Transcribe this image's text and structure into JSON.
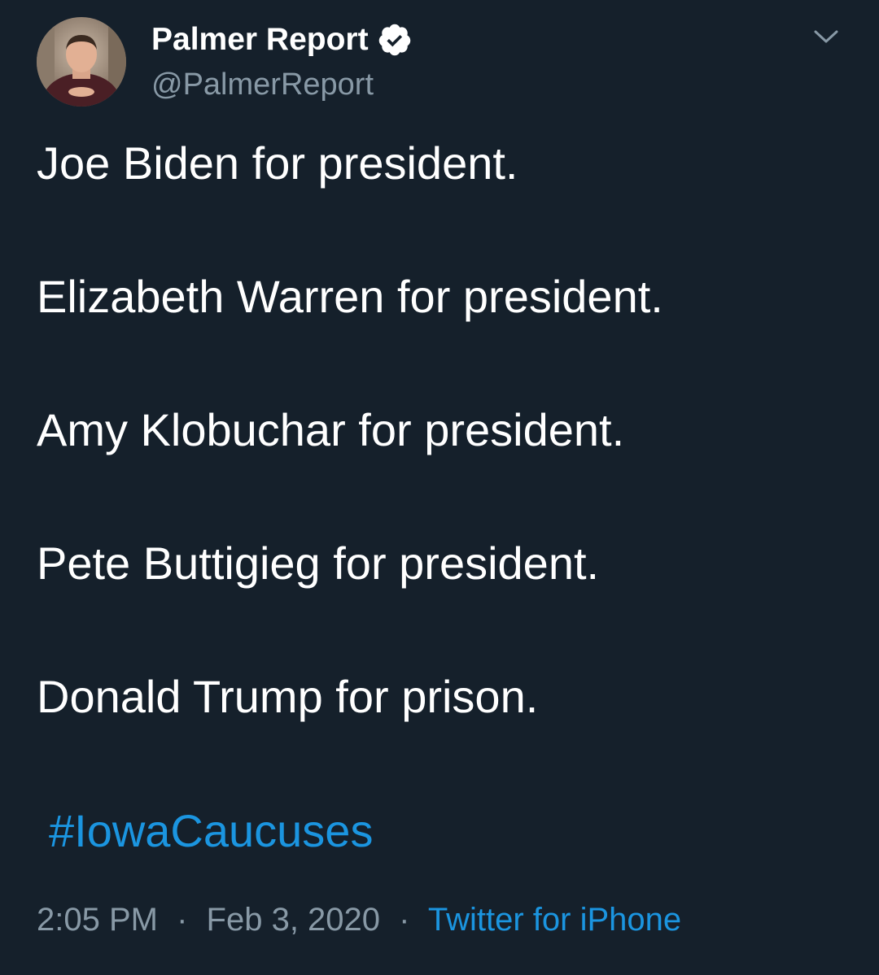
{
  "user": {
    "display_name": "Palmer Report",
    "handle": "@PalmerReport",
    "verified": true
  },
  "tweet": {
    "lines": [
      "Joe Biden for president.",
      "Elizabeth Warren for president.",
      "Amy Klobuchar for president.",
      "Pete Buttigieg for president.",
      "Donald Trump for prison."
    ],
    "hashtag": "#IowaCaucuses"
  },
  "meta": {
    "time": "2:05 PM",
    "separator": "·",
    "date": "Feb 3, 2020",
    "source": "Twitter for iPhone"
  },
  "icons": {
    "verified": "verified-badge-icon",
    "menu": "chevron-down-icon"
  },
  "colors": {
    "background": "#15202b",
    "text": "#ffffff",
    "secondary": "#8899a6",
    "link": "#1b95e0"
  }
}
